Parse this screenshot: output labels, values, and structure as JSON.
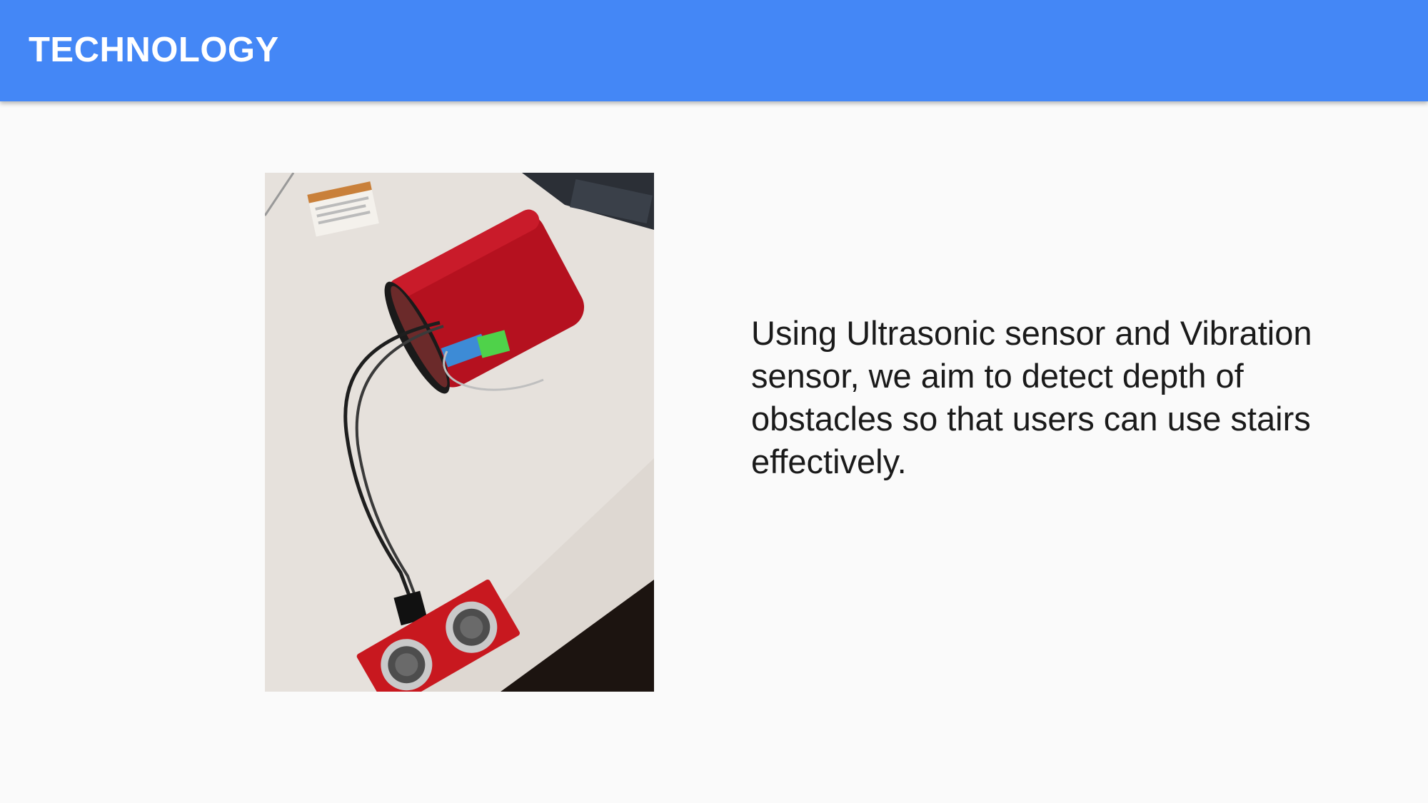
{
  "slide": {
    "title": "TECHNOLOGY",
    "body": "Using Ultrasonic sensor and Vibration sensor, we aim to detect depth of obstacles so that users can use stairs effectively.",
    "photo_subject": "ultrasonic-sensor-prototype-photo"
  },
  "colors": {
    "header_bg": "#4487f6",
    "title_text": "#ffffff",
    "body_text": "#1a1a1a",
    "slide_bg": "#fafafa"
  }
}
